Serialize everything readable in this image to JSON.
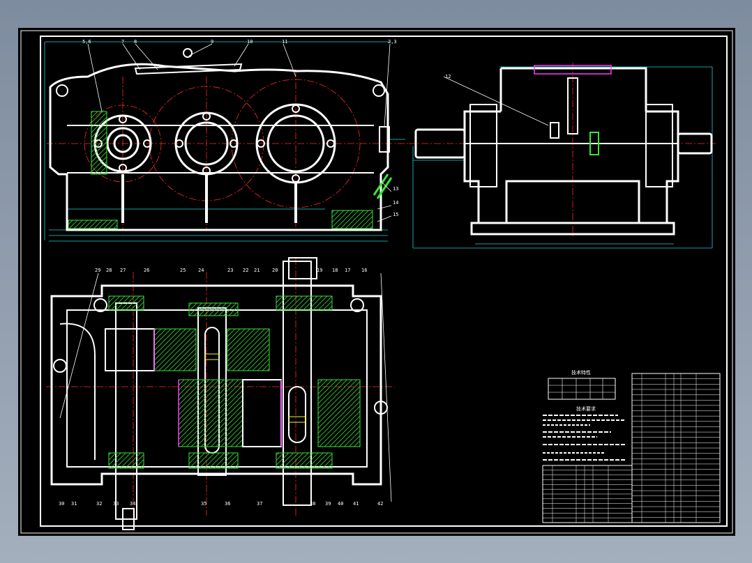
{
  "drawing": {
    "background": "#000000",
    "line_color": "#ffffff",
    "center_line_color": "#ff2a2a",
    "dimension_color": "#1fd0d6",
    "hatch_color": "#39e639",
    "part_colors": {
      "magenta": "#ff3bff",
      "yellow": "#f2f23a"
    }
  },
  "front_view": {
    "balloons_top": [
      "5,6",
      "7",
      "8",
      "9",
      "10",
      "11",
      "2,3"
    ],
    "balloons_right": [
      "13",
      "14",
      "15"
    ]
  },
  "side_view": {
    "balloon": "12"
  },
  "plan_view": {
    "balloons_top": [
      "29",
      "28",
      "27",
      "26",
      "25",
      "24",
      "23",
      "22",
      "21",
      "20",
      "19",
      "18",
      "17",
      "16"
    ],
    "balloons_bottom": [
      "30",
      "31",
      "32",
      "33",
      "34",
      "35",
      "36",
      "37",
      "38",
      "39",
      "40",
      "41",
      "42"
    ]
  },
  "tech_block": {
    "spec_title": "技术特性",
    "req_title": "技术要求"
  }
}
